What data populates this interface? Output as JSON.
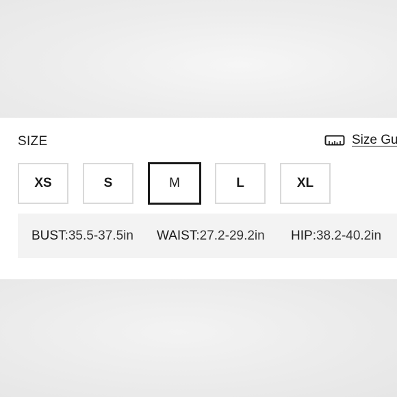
{
  "size_section": {
    "title": "SIZE",
    "guide": {
      "label": "Size Gu",
      "icon": "ruler-icon"
    },
    "options": [
      {
        "label": "XS",
        "selected": false
      },
      {
        "label": "S",
        "selected": false
      },
      {
        "label": "M",
        "selected": true
      },
      {
        "label": "L",
        "selected": false
      },
      {
        "label": "XL",
        "selected": false
      }
    ],
    "measurements": [
      {
        "label": "BUST",
        "value": ":35.5-37.5in"
      },
      {
        "label": "WAIST",
        "value": ":27.2-29.2in"
      },
      {
        "label": "HIP",
        "value": ":38.2-40.2in"
      }
    ]
  },
  "colors": {
    "selected_border": "#1a1a1a",
    "option_border": "#d9d9d9",
    "measure_background": "#f3f3f3"
  }
}
